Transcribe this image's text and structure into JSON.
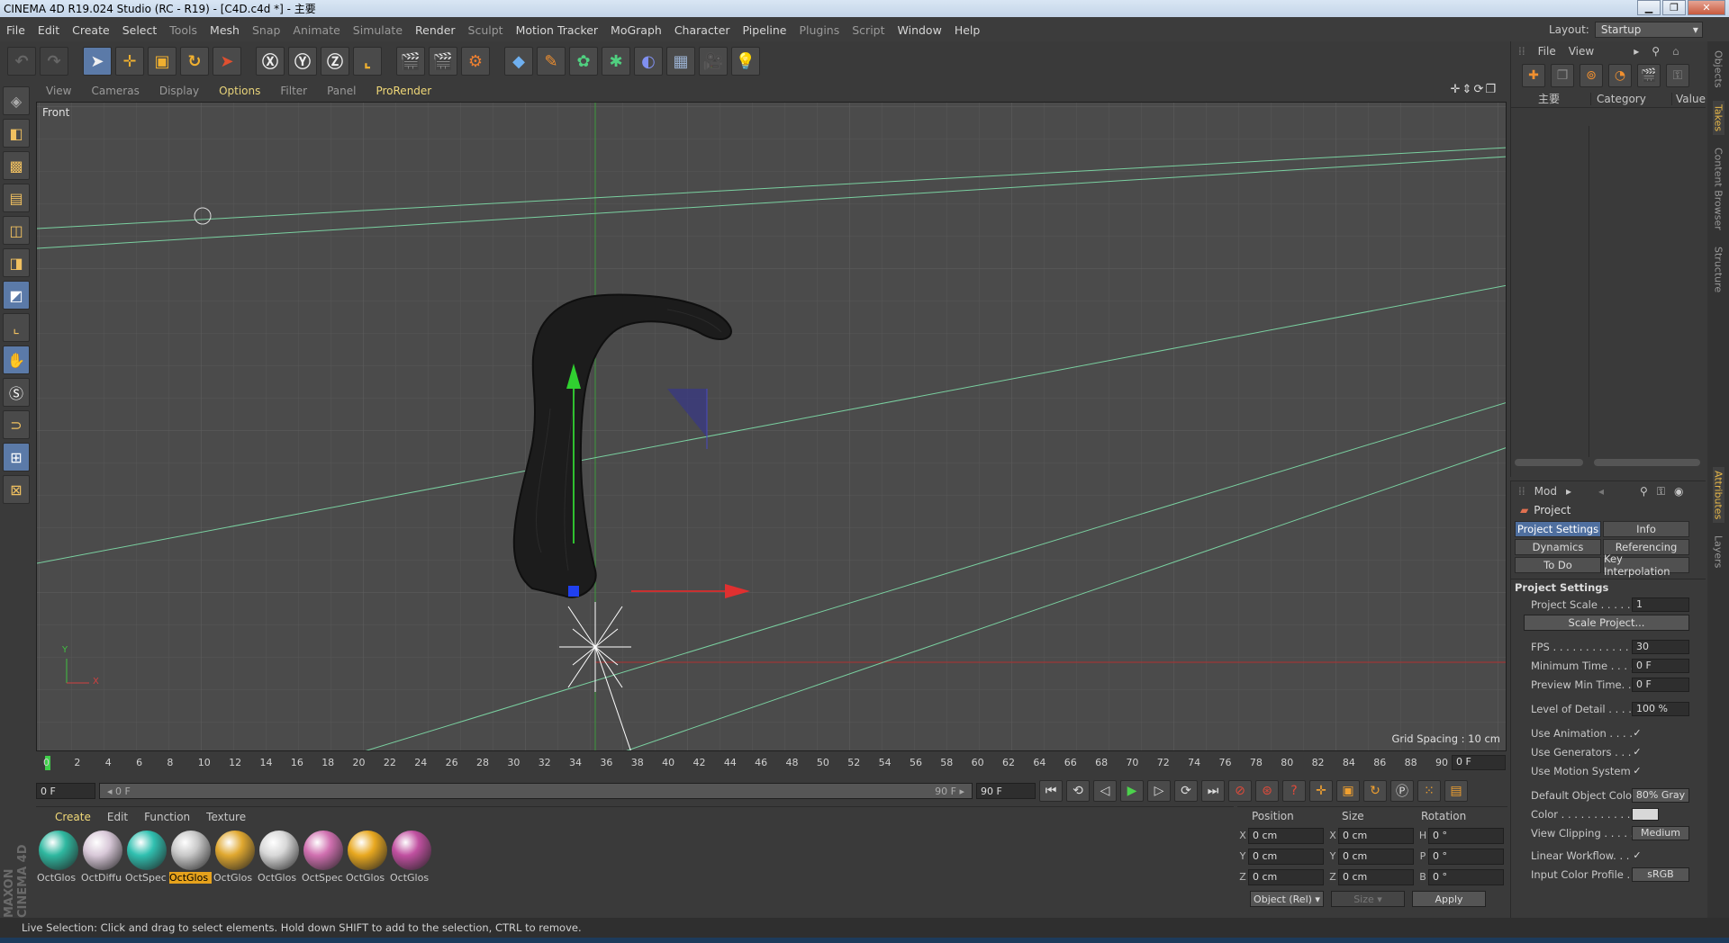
{
  "window": {
    "title": "CINEMA 4D R19.024 Studio (RC - R19) - [C4D.c4d *] - 主要",
    "minimize": "▁",
    "maximize": "❐",
    "close": "✕"
  },
  "menu": [
    "File",
    "Edit",
    "Create",
    "Select",
    "Tools",
    "Mesh",
    "Snap",
    "Animate",
    "Simulate",
    "Render",
    "Sculpt",
    "Motion Tracker",
    "MoGraph",
    "Character",
    "Pipeline",
    "Plugins",
    "Script",
    "Window",
    "Help"
  ],
  "layout": {
    "label": "Layout:",
    "value": "Startup"
  },
  "viewport_menu": [
    "View",
    "Cameras",
    "Display",
    "Options",
    "Filter",
    "Panel",
    "ProRender"
  ],
  "viewport": {
    "name": "Front",
    "grid_spacing": "Grid Spacing : 10 cm",
    "axis_y": "Y",
    "axis_x": "X"
  },
  "timeline": {
    "ticks": [
      "0",
      "2",
      "4",
      "6",
      "8",
      "10",
      "12",
      "14",
      "16",
      "18",
      "20",
      "22",
      "24",
      "26",
      "28",
      "30",
      "32",
      "34",
      "36",
      "38",
      "40",
      "42",
      "44",
      "46",
      "48",
      "50",
      "52",
      "54",
      "56",
      "58",
      "60",
      "62",
      "64",
      "66",
      "68",
      "70",
      "72",
      "74",
      "76",
      "78",
      "80",
      "82",
      "84",
      "86",
      "88",
      "90"
    ],
    "current_frame": "0 F",
    "start": "0 F",
    "slider_start": "◂ 0 F",
    "slider_end": "90 F ▸",
    "end": "90 F"
  },
  "material_menu": [
    "Create",
    "Edit",
    "Function",
    "Texture"
  ],
  "materials": [
    {
      "name": "OctGlos",
      "color": "#2fb8a0"
    },
    {
      "name": "OctDiffu",
      "color": "#d8c8d8"
    },
    {
      "name": "OctSpec",
      "color": "#30c0b0"
    },
    {
      "name": "OctGlos",
      "color": "#c8c8c8"
    },
    {
      "name": "OctGlos",
      "color": "#e0a830"
    },
    {
      "name": "OctGlos",
      "color": "#d8d8d8"
    },
    {
      "name": "OctSpec",
      "color": "#d070b0"
    },
    {
      "name": "OctGlos",
      "color": "#e8a820"
    },
    {
      "name": "OctGlos",
      "color": "#c050a0"
    }
  ],
  "coords": {
    "headers": [
      "Position",
      "Size",
      "Rotation"
    ],
    "rows": [
      {
        "l1": "X",
        "v1": "0 cm",
        "l2": "X",
        "v2": "0 cm",
        "l3": "H",
        "v3": "0 °"
      },
      {
        "l1": "Y",
        "v1": "0 cm",
        "l2": "Y",
        "v2": "0 cm",
        "l3": "P",
        "v3": "0 °"
      },
      {
        "l1": "Z",
        "v1": "0 cm",
        "l2": "Z",
        "v2": "0 cm",
        "l3": "B",
        "v3": "0 °"
      }
    ],
    "mode": "Object (Rel) ▾",
    "size_mode": "Size ▾",
    "apply": "Apply"
  },
  "status": "Live Selection: Click and drag to select elements. Hold down SHIFT to add to the selection, CTRL to remove.",
  "objects": {
    "menu": [
      "File",
      "View"
    ],
    "columns": [
      "主要",
      "Category",
      "Value"
    ]
  },
  "attributes": {
    "menu": "Mod",
    "title": "Project",
    "tabs": [
      "Project Settings",
      "Info",
      "Dynamics",
      "Referencing",
      "To Do",
      "Key Interpolation"
    ],
    "section": "Project Settings",
    "rows": {
      "project_scale": {
        "label": "Project Scale . . . . . .",
        "value": "1"
      },
      "scale_button": "Scale Project...",
      "fps": {
        "label": "FPS . . . . . . . . . . . . . . .",
        "value": "30"
      },
      "min_time": {
        "label": "Minimum Time . . . .",
        "value": "0 F"
      },
      "preview_min": {
        "label": "Preview Min Time. . .",
        "value": "0 F"
      },
      "lod": {
        "label": "Level of Detail . . . . .",
        "value": "100 %"
      },
      "use_animation": {
        "label": "Use Animation . . . . .",
        "value": "✓"
      },
      "use_generators": {
        "label": "Use Generators . . . .",
        "value": "✓"
      },
      "use_motion": {
        "label": "Use Motion System",
        "value": "✓"
      },
      "default_color": {
        "label": "Default Object Color",
        "value": "80% Gray"
      },
      "color": {
        "label": "Color . . . . . . . . . . . .",
        "value": ""
      },
      "view_clipping": {
        "label": "View Clipping . . . . . .",
        "value": "Medium"
      },
      "linear_workflow": {
        "label": "Linear Workflow. . . .",
        "value": "✓"
      },
      "color_profile": {
        "label": "Input Color Profile . .",
        "value": "sRGB"
      }
    }
  },
  "side_tabs": [
    "Objects",
    "Takes",
    "Content Browser",
    "Structure",
    "Attributes",
    "Layers"
  ],
  "brand": "MAXON CINEMA 4D"
}
